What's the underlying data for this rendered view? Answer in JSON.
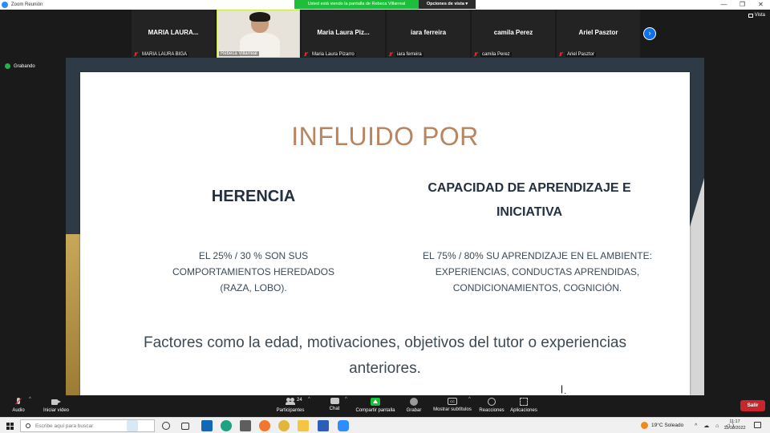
{
  "window": {
    "title": "Zoom Reunión",
    "controls": [
      "—",
      "❐",
      "✕"
    ]
  },
  "share_banner": "Usted está viendo la pantalla de Rebeca Villarreal",
  "view_options": "Opciones de vista ▾",
  "vista_label": "Vista",
  "recording_label": "Grabando",
  "gallery": {
    "tiles": [
      {
        "center": "MARIA LAURA...",
        "name": "MARIA LAURA BIGA"
      },
      {
        "center": "",
        "name": "Rebeca Villarreal",
        "video": true
      },
      {
        "center": "Maria Laura Piz...",
        "name": "Maria Laura Pizarro"
      },
      {
        "center": "iara ferreira",
        "name": "iara ferreira"
      },
      {
        "center": "camila Perez",
        "name": "camila Perez"
      },
      {
        "center": "Ariel Pasztor",
        "name": "Ariel Pasztor"
      }
    ]
  },
  "slide": {
    "title": "INFLUIDO POR",
    "left_heading": "HERENCIA",
    "right_heading": "CAPACIDAD DE APRENDIZAJE E INICIATIVA",
    "left_text": "EL 25% / 30 % SON SUS COMPORTAMIENTOS HEREDADOS (RAZA, LOBO).",
    "right_text": "EL 75% / 80% SU APRENDIZAJE EN EL AMBIENTE: EXPERIENCIAS, CONDUCTAS APRENDIDAS, CONDICIONAMIENTOS, COGNICIÓN.",
    "footer": "Factores como la edad, motivaciones, objetivos del tutor o experiencias anteriores."
  },
  "toolbar": {
    "audio": "Audio",
    "video": "Iniciar video",
    "participants": "Participantes",
    "participants_count": "24",
    "chat": "Chat",
    "share": "Compartir pantalla",
    "record": "Grabar",
    "subtitles": "Mostrar subtítulos",
    "subtitles_icon": "CC",
    "reactions": "Reacciones",
    "apps": "Aplicaciones",
    "leave": "Salir"
  },
  "taskbar": {
    "search_placeholder": "Escribe aquí para buscar",
    "weather": "19°C  Soleado",
    "tray": "^ ☁ ⌂ ◁)",
    "time": "11:17",
    "date": "11/10/2022"
  },
  "colors": {
    "zoom_blue": "#0e72ed",
    "share_green": "#1dbf3a",
    "leave_red": "#c9252c",
    "slide_title": "#b9845e",
    "slide_heading": "#243040"
  }
}
